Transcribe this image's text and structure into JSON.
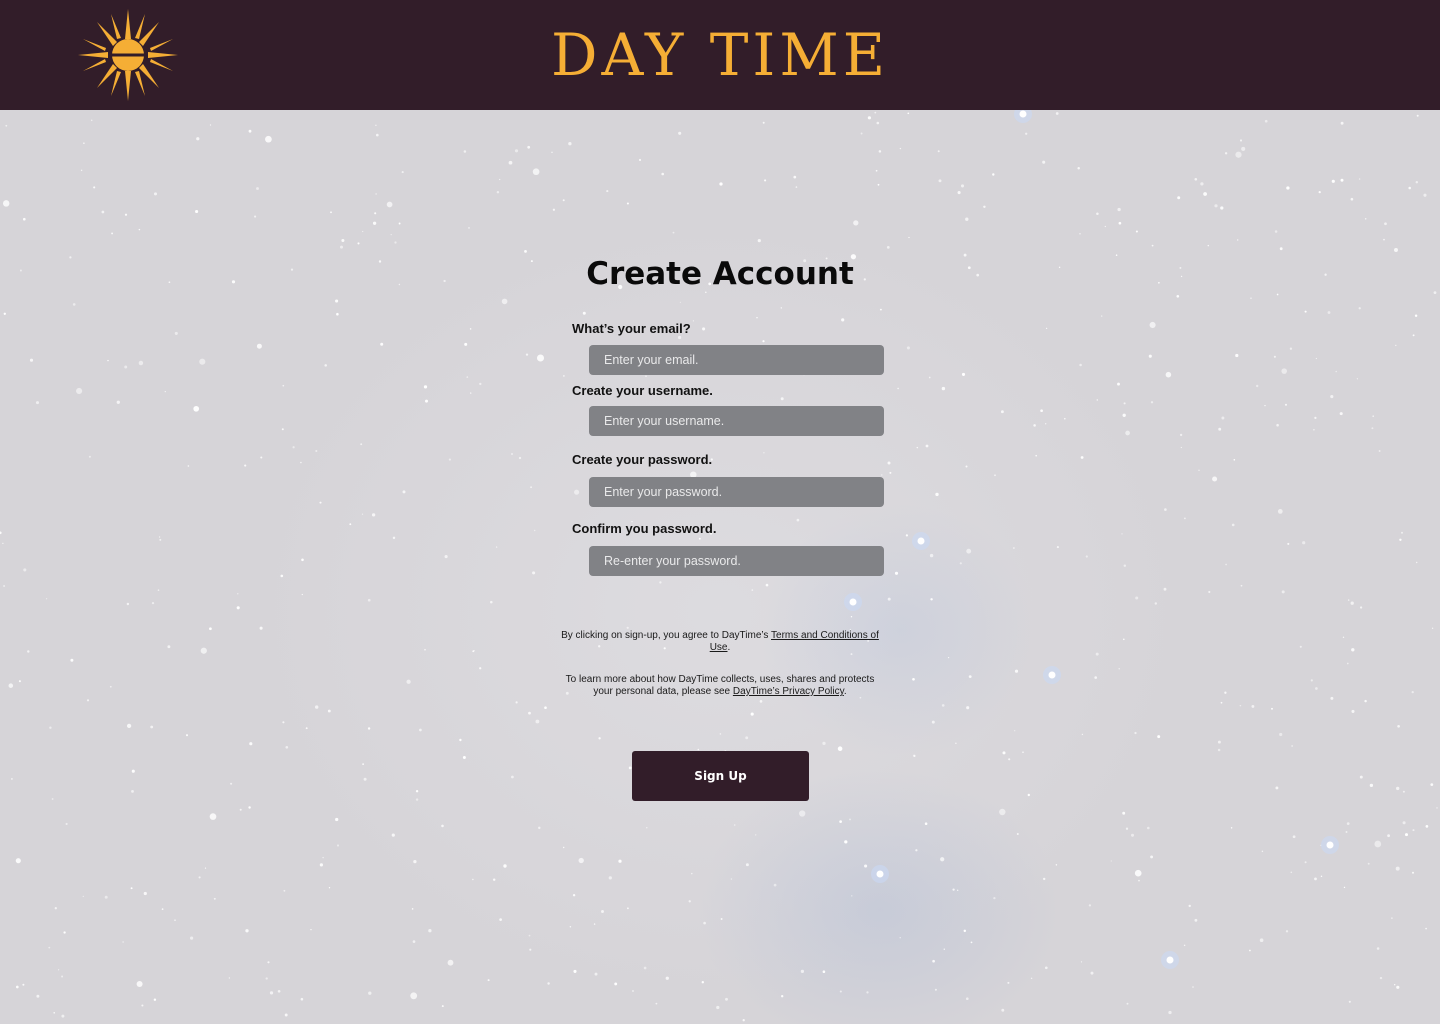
{
  "header": {
    "brand_title": "DAY TIME",
    "logo_icon": "sun-icon",
    "background_color": "#321d29",
    "accent_color": "#f5ae35"
  },
  "form": {
    "title": "Create Account",
    "fields": [
      {
        "label": "What’s your email?",
        "placeholder": "Enter your email.",
        "value": ""
      },
      {
        "label": "Create your username.",
        "placeholder": "Enter your username.",
        "value": ""
      },
      {
        "label": "Create your password.",
        "placeholder": "Enter your password.",
        "value": ""
      },
      {
        "label": "Confirm you password.",
        "placeholder": "Re-enter your password.",
        "value": ""
      }
    ],
    "terms": {
      "prefix": "By clicking on sign-up, you agree to DayTime’s ",
      "link": "Terms and Conditions of Use",
      "suffix": "."
    },
    "privacy": {
      "prefix": "To learn more about how DayTime collects, uses, shares and protects your personal data, please see ",
      "link": "DayTime’s Privacy Policy",
      "suffix": "."
    },
    "submit_label": "Sign Up"
  }
}
